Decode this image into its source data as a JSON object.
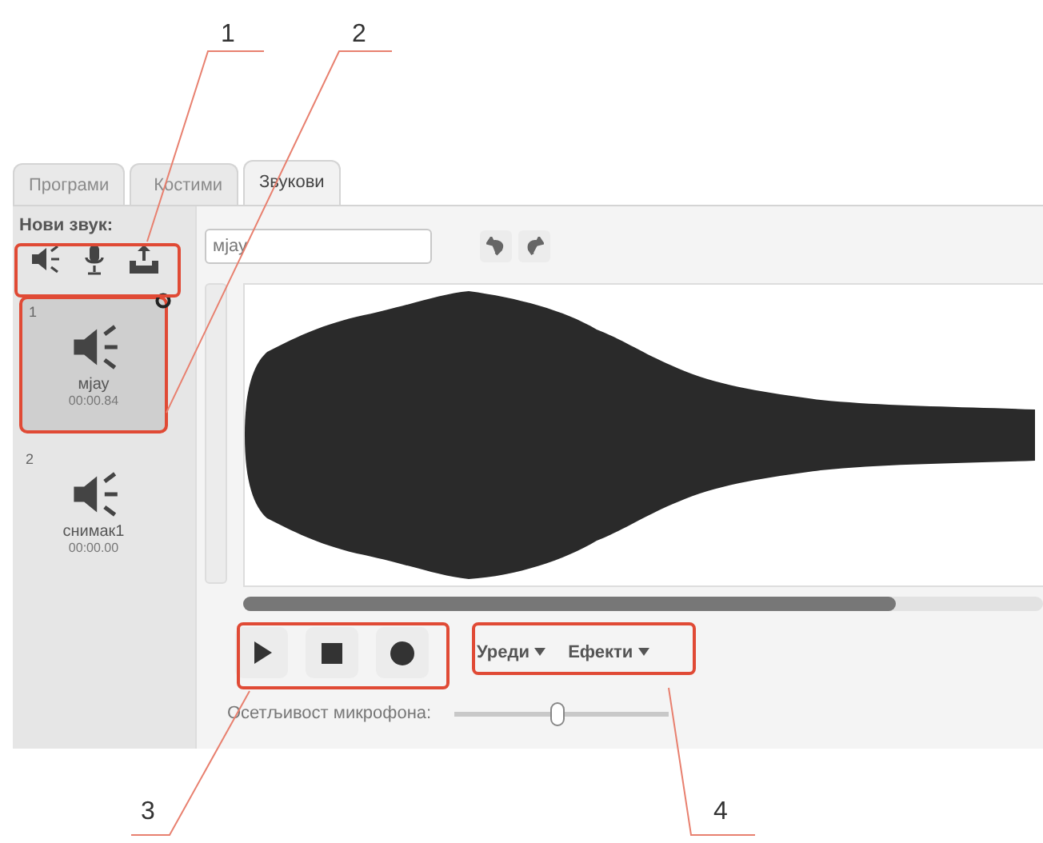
{
  "callouts": [
    {
      "label": "1"
    },
    {
      "label": "2"
    },
    {
      "label": "3"
    },
    {
      "label": "4"
    }
  ],
  "tabs": [
    {
      "label": "Програми",
      "selected": false
    },
    {
      "label": "Костими",
      "selected": false
    },
    {
      "label": "Звукови",
      "selected": true
    }
  ],
  "new_sound": {
    "label": "Нови звук:"
  },
  "sounds": [
    {
      "index": "1",
      "name": "мјау",
      "duration": "00:00.84",
      "selected": true
    },
    {
      "index": "2",
      "name": "снимак1",
      "duration": "00:00.00",
      "selected": false
    }
  ],
  "sound_name": {
    "value": "мјау"
  },
  "menus": [
    {
      "label": "Уреди"
    },
    {
      "label": "Ефекти"
    }
  ],
  "mic_sensitivity": {
    "label": "Осетљивост микрофона:",
    "level": 0.48
  }
}
